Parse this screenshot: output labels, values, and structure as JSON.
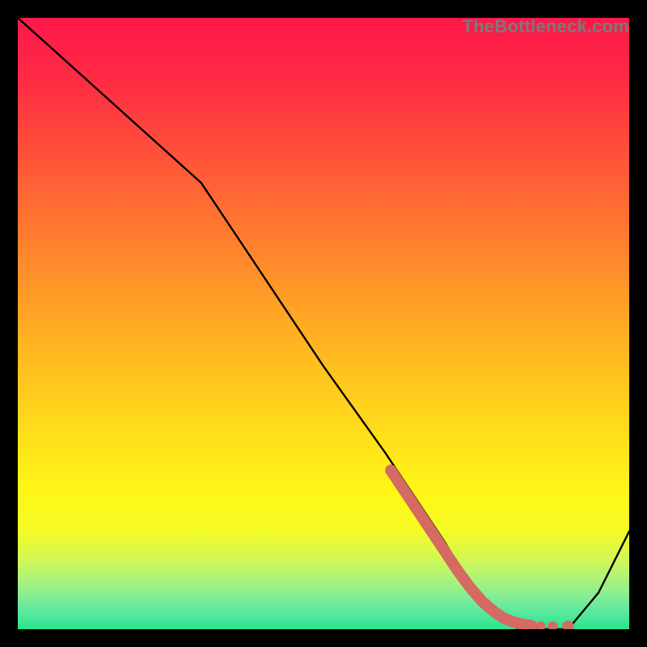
{
  "watermark": "TheBottleneck.com",
  "chart_data": {
    "type": "line",
    "title": "",
    "xlabel": "",
    "ylabel": "",
    "xlim": [
      0,
      100
    ],
    "ylim": [
      0,
      100
    ],
    "grid": false,
    "legend": false,
    "series": [
      {
        "name": "curve",
        "x": [
          0,
          10,
          20,
          30,
          40,
          50,
          60,
          70,
          74,
          78,
          82,
          86,
          90,
          95,
          100
        ],
        "y": [
          100,
          91,
          82,
          73,
          58,
          43,
          29,
          14,
          7,
          2,
          0,
          0,
          0,
          6,
          16
        ]
      }
    ],
    "highlight_segment": {
      "name": "highlight",
      "x": [
        61,
        64,
        67,
        70,
        72,
        74,
        76,
        78,
        79.5,
        81,
        82.5,
        84
      ],
      "y": [
        26,
        21.5,
        17,
        12.5,
        9.5,
        6.8,
        4.5,
        2.8,
        1.8,
        1.2,
        0.8,
        0.6
      ]
    },
    "highlight_dots": {
      "x": [
        85.5,
        87.5,
        90
      ],
      "y": [
        0.5,
        0.5,
        0.5
      ]
    },
    "gradient_stops": [
      {
        "offset": 0.0,
        "color": "#ff1749"
      },
      {
        "offset": 0.1,
        "color": "#ff2b44"
      },
      {
        "offset": 0.2,
        "color": "#ff4a3b"
      },
      {
        "offset": 0.3,
        "color": "#ff6a33"
      },
      {
        "offset": 0.4,
        "color": "#ff8a2b"
      },
      {
        "offset": 0.5,
        "color": "#ffaa24"
      },
      {
        "offset": 0.6,
        "color": "#ffc81e"
      },
      {
        "offset": 0.7,
        "color": "#ffe31a"
      },
      {
        "offset": 0.78,
        "color": "#fff717"
      },
      {
        "offset": 0.84,
        "color": "#f4fb27"
      },
      {
        "offset": 0.88,
        "color": "#d7f84f"
      },
      {
        "offset": 0.91,
        "color": "#b6f472"
      },
      {
        "offset": 0.94,
        "color": "#8eef8f"
      },
      {
        "offset": 0.97,
        "color": "#5ee99f"
      },
      {
        "offset": 1.0,
        "color": "#27e38f"
      }
    ],
    "colors": {
      "curve": "#000000",
      "highlight": "#d46a62"
    }
  }
}
